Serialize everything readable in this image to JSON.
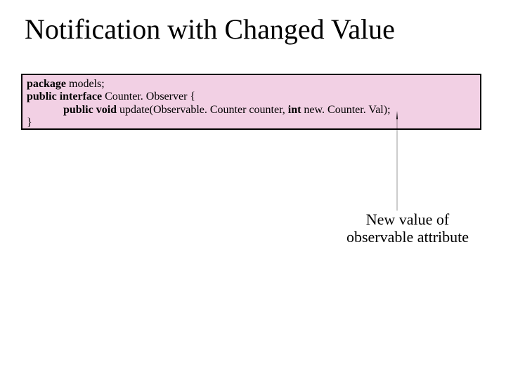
{
  "title": "Notification with Changed Value",
  "code": {
    "line1_kw": "package ",
    "line1_rest": "models; ",
    "line2_kw1": "public interface ",
    "line2_mid": "Counter. Observer {",
    "line3_indent": "             ",
    "line3_kw": "public void ",
    "line3_mid": "update(Observable. Counter counter, ",
    "line3_kw2": "int ",
    "line3_end": "new. Counter. Val); ",
    "line4": "}"
  },
  "annotation": {
    "line1": "New value of",
    "line2": "observable attribute"
  }
}
